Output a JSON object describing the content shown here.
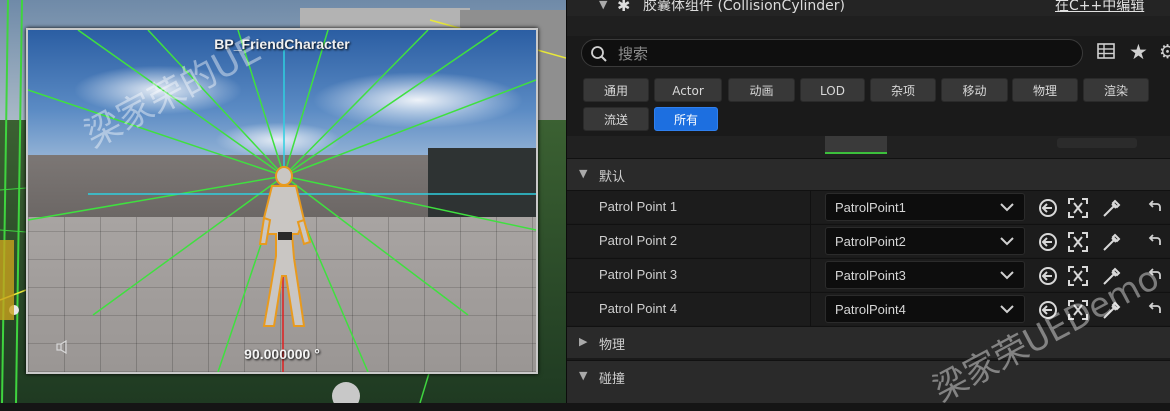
{
  "viewport": {
    "preview_title": "BP_FriendCharacter",
    "rotation_readout": "90.000000 °",
    "speaker_icon": "speaker-icon"
  },
  "details": {
    "component_title": "胶囊体组件 (CollisionCylinder)",
    "edit_in_cpp": "在C++中编辑",
    "search": {
      "placeholder": "搜索",
      "value": ""
    },
    "filters": [
      {
        "label": "通用",
        "active": false
      },
      {
        "label": "Actor",
        "active": false
      },
      {
        "label": "动画",
        "active": false
      },
      {
        "label": "LOD",
        "active": false
      },
      {
        "label": "杂项",
        "active": false
      },
      {
        "label": "移动",
        "active": false
      },
      {
        "label": "物理",
        "active": false
      },
      {
        "label": "渲染",
        "active": false
      },
      {
        "label": "流送",
        "active": false
      },
      {
        "label": "所有",
        "active": true
      }
    ],
    "sections": {
      "default": {
        "label": "默认",
        "expanded": true
      },
      "physics": {
        "label": "物理",
        "expanded": false
      },
      "collision": {
        "label": "碰撞",
        "expanded": true
      }
    },
    "properties": [
      {
        "label": "Patrol Point 1",
        "value": "PatrolPoint1"
      },
      {
        "label": "Patrol Point 2",
        "value": "PatrolPoint2"
      },
      {
        "label": "Patrol Point 3",
        "value": "PatrolPoint3"
      },
      {
        "label": "Patrol Point 4",
        "value": "PatrolPoint4"
      }
    ],
    "row_icons": [
      "use-selected-icon",
      "browse-icon",
      "eyedropper-icon",
      "reset-icon"
    ],
    "accent_color": "#1d6fe0"
  },
  "watermarks": [
    {
      "text": "梁家荣的UE"
    },
    {
      "text": "梁家荣UEDemo"
    }
  ]
}
